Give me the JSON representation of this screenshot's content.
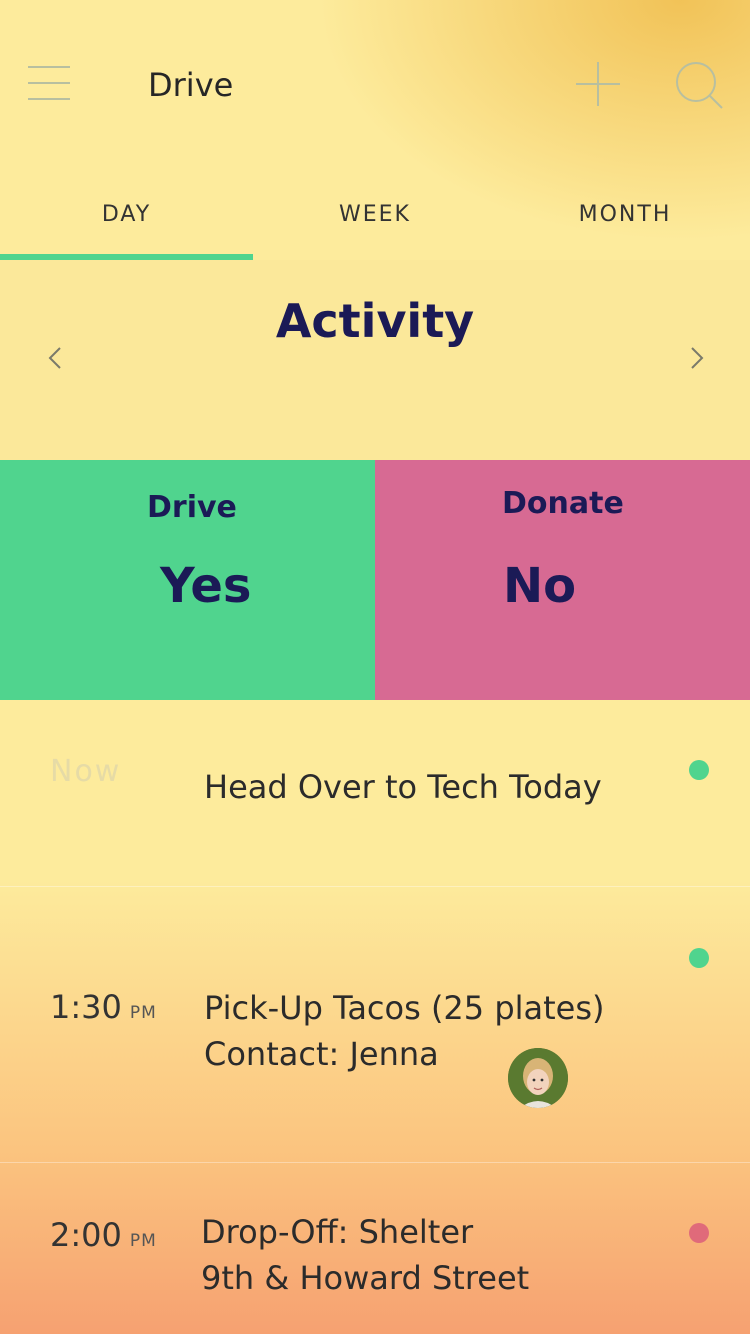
{
  "header": {
    "title": "Drive",
    "icons": {
      "menu": "hamburger-menu-icon",
      "add": "plus-icon",
      "search": "search-icon"
    }
  },
  "tabs": [
    {
      "label": "DAY",
      "selected": true
    },
    {
      "label": "WEEK",
      "selected": false
    },
    {
      "label": "MONTH",
      "selected": false
    }
  ],
  "activity": {
    "title": "Activity",
    "prev_icon": "chevron-left-icon",
    "next_icon": "chevron-right-icon"
  },
  "tiles": [
    {
      "label": "Drive",
      "value": "Yes",
      "color": "#50d48e"
    },
    {
      "label": "Donate",
      "value": "No",
      "color": "#d76a93"
    }
  ],
  "schedule": [
    {
      "time": "Now",
      "period": "",
      "lines": [
        "Head Over to Tech Today"
      ],
      "status_color": "#50d48e"
    },
    {
      "time": "1:30",
      "period": "PM",
      "lines": [
        "Pick-Up Tacos (25 plates)",
        "Contact:  Jenna"
      ],
      "status_color": "#50d48e",
      "avatar": "contact-avatar"
    },
    {
      "time": "2:00",
      "period": "PM",
      "lines": [
        "Drop-Off: Shelter",
        "9th & Howard Street"
      ],
      "status_color": "#e06a7a"
    }
  ],
  "colors": {
    "accent_green": "#50d48e",
    "accent_pink": "#d76a93",
    "text_navy": "#1b1a56"
  }
}
